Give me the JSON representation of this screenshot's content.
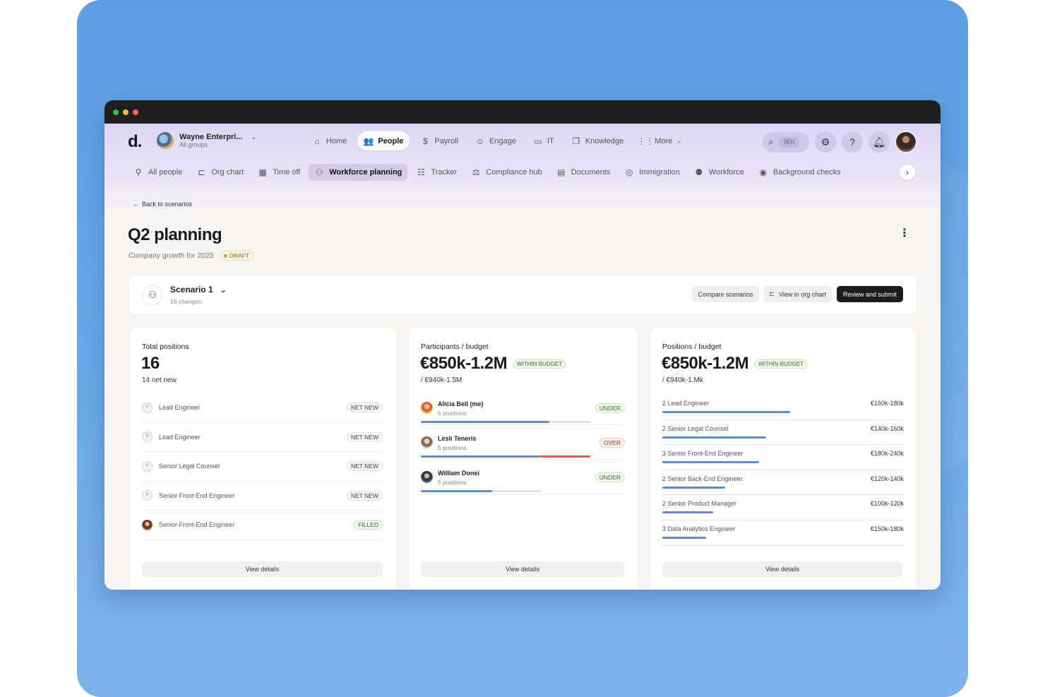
{
  "colors": {
    "accent_blue": "#5a8fd6",
    "over_red": "#e0603a",
    "bg_blue": "#5d9de3",
    "nav_bg": "#ddd7f7",
    "primary_dark": "#1c1c1c"
  },
  "window": {
    "traffic_lights": [
      "#27c93f",
      "#ffbd2e",
      "#ff5f56"
    ]
  },
  "header": {
    "logo": "d.",
    "org_name": "Wayne Enterpri...",
    "org_sub": "All groups",
    "nav": [
      {
        "label": "Home",
        "icon": "home-icon",
        "glyph": "⌂",
        "active": false
      },
      {
        "label": "People",
        "icon": "people-icon",
        "glyph": "👥",
        "active": true
      },
      {
        "label": "Payroll",
        "icon": "payroll-icon",
        "glyph": "$",
        "active": false
      },
      {
        "label": "Engage",
        "icon": "engage-icon",
        "glyph": "☺",
        "active": false
      },
      {
        "label": "IT",
        "icon": "laptop-icon",
        "glyph": "▭",
        "active": false
      },
      {
        "label": "Knowledge",
        "icon": "book-icon",
        "glyph": "❒",
        "active": false
      },
      {
        "label": "More",
        "icon": "grid-icon",
        "glyph": "⋮⋮",
        "active": false
      }
    ],
    "search_shortcut": "⌘K"
  },
  "subnav": {
    "items": [
      {
        "label": "All people",
        "icon": "person-search-icon",
        "glyph": "⚲",
        "active": false
      },
      {
        "label": "Org chart",
        "icon": "org-chart-icon",
        "glyph": "⊏",
        "active": false
      },
      {
        "label": "Time off",
        "icon": "calendar-icon",
        "glyph": "▦",
        "active": false
      },
      {
        "label": "Workforce planning",
        "icon": "workforce-planning-icon",
        "glyph": "⚇",
        "active": true
      },
      {
        "label": "Tracker",
        "icon": "tracker-icon",
        "glyph": "☷",
        "active": false
      },
      {
        "label": "Compliance hub",
        "icon": "gavel-icon",
        "glyph": "⚖",
        "active": false
      },
      {
        "label": "Documents",
        "icon": "document-icon",
        "glyph": "▤",
        "active": false
      },
      {
        "label": "Immigration",
        "icon": "globe-icon",
        "glyph": "◎",
        "active": false
      },
      {
        "label": "Workforce",
        "icon": "workforce-icon",
        "glyph": "⚉",
        "active": false
      },
      {
        "label": "Background checks",
        "icon": "fingerprint-icon",
        "glyph": "◉",
        "active": false
      }
    ]
  },
  "page": {
    "back_label": "Back to scenarios",
    "title": "Q2 planning",
    "subtitle": "Company growth for 2025",
    "status": "DRAFT"
  },
  "scenario": {
    "name": "Scenario 1",
    "changes": "16 changes",
    "compare_label": "Compare scenarios",
    "org_chart_label": "View in org chart",
    "submit_label": "Review and submit"
  },
  "cards": {
    "positions": {
      "label": "Total positions",
      "value": "16",
      "sub": "14 net new",
      "rows": [
        {
          "title": "Lead Engineer",
          "tag": "NET NEW",
          "filled": false
        },
        {
          "title": "Lead Engineer",
          "tag": "NET NEW",
          "filled": false
        },
        {
          "title": "Senior Legal Counsel",
          "tag": "NET NEW",
          "filled": false
        },
        {
          "title": "Senior Front-End Engineer",
          "tag": "NET NEW",
          "filled": false
        },
        {
          "title": "Senior Front-End Engineer",
          "tag": "FILLED",
          "filled": true
        }
      ],
      "view_label": "View details"
    },
    "participants": {
      "label": "Participants / budget",
      "value": "€850k-1.2M",
      "badge": "WITHIN BUDGET",
      "sub": "/ €940k-1.5M",
      "rows": [
        {
          "name": "Alicia Bell (me)",
          "positions": "6 positions",
          "tag": "UNDER",
          "status": "under",
          "fill_fraction": 0.63,
          "track_fraction": 0.83
        },
        {
          "name": "Lesli Teneris",
          "positions": "5 positions",
          "tag": "OVER",
          "status": "over",
          "fill_fraction": 0.58,
          "over_fraction": 0.25,
          "track_fraction": 0.83
        },
        {
          "name": "William Donei",
          "positions": "5 positions",
          "tag": "UNDER",
          "status": "under",
          "fill_fraction": 0.35,
          "track_fraction": 0.59
        }
      ],
      "view_label": "View details"
    },
    "positions_budget": {
      "label": "Positions / budget",
      "value": "€850k-1.2M",
      "badge": "WITHIN BUDGET",
      "sub": "/ €940k-1.Mk",
      "rows": [
        {
          "name": "2 Lead Engineer",
          "range": "€160k-180k",
          "fill_fraction": 0.53
        },
        {
          "name": "2 Senior Legal Counsel",
          "range": "€140k-160k",
          "fill_fraction": 0.43
        },
        {
          "name": "3 Senior Front-End Engineer",
          "range": "€180k-240k",
          "fill_fraction": 0.4
        },
        {
          "name": "2 Senior Back-End Engineer",
          "range": "€120k-140k",
          "fill_fraction": 0.26
        },
        {
          "name": "2 Senior Product Manager",
          "range": "€100k-120k",
          "fill_fraction": 0.21
        },
        {
          "name": "3 Data Analytics Engineer",
          "range": "€150k-180k",
          "fill_fraction": 0.18
        }
      ],
      "view_label": "View details"
    }
  }
}
